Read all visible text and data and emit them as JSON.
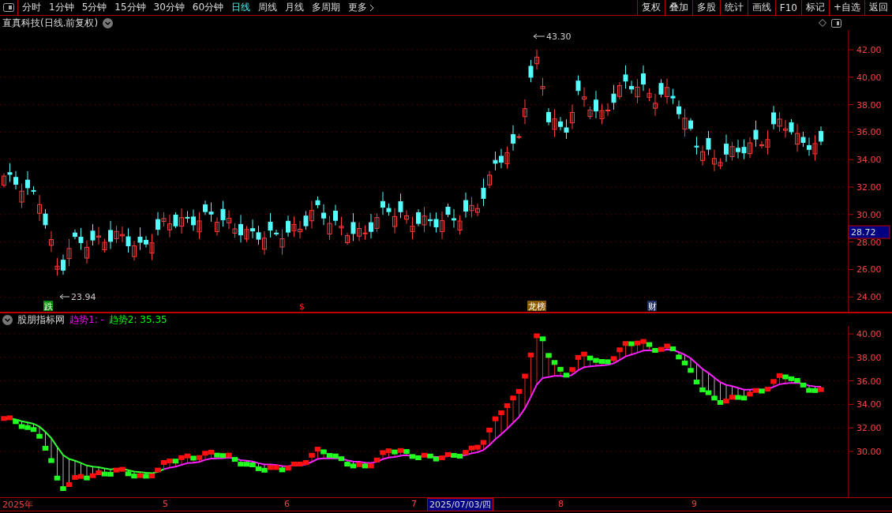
{
  "toolbar": {
    "periods": [
      {
        "label": "分时",
        "selected": false
      },
      {
        "label": "1分钟",
        "selected": false
      },
      {
        "label": "5分钟",
        "selected": false
      },
      {
        "label": "15分钟",
        "selected": false
      },
      {
        "label": "30分钟",
        "selected": false
      },
      {
        "label": "60分钟",
        "selected": false
      },
      {
        "label": "日线",
        "selected": true
      },
      {
        "label": "周线",
        "selected": false
      },
      {
        "label": "月线",
        "selected": false
      },
      {
        "label": "多周期",
        "selected": false
      },
      {
        "label": "更多",
        "selected": false
      }
    ],
    "buttons": [
      "复权",
      "叠加",
      "多股",
      "统计",
      "画线",
      "F10",
      "标记",
      "+自选",
      "返回"
    ]
  },
  "chart": {
    "title": "直真科技(日线.前复权)",
    "high_label": "43.30",
    "low_label": "23.94",
    "current_price": "28.72",
    "y_axis_labels": [
      "42.00",
      "40.00",
      "38.00",
      "36.00",
      "34.00",
      "32.00",
      "30.00",
      "28.00",
      "26.00",
      "24.00"
    ],
    "events": [
      {
        "label": "跌",
        "kind": "drop"
      },
      {
        "label": "$",
        "kind": "dollar"
      },
      {
        "label": "龙榜",
        "kind": "rank"
      },
      {
        "label": "财",
        "kind": "finance"
      }
    ]
  },
  "indicator": {
    "name": "股朋指标网",
    "legend": [
      {
        "label": "趋势1: -",
        "color": "#ff00ff"
      },
      {
        "label": "趋势2: 35.35",
        "color": "#00ff00"
      }
    ],
    "y_axis_labels": [
      "40.00",
      "38.00",
      "36.00",
      "34.00",
      "32.00",
      "30.00"
    ]
  },
  "date_axis": [
    {
      "label": "2025年",
      "selected": false
    },
    {
      "label": "5",
      "selected": false
    },
    {
      "label": "6",
      "selected": false
    },
    {
      "label": "7",
      "selected": false
    },
    {
      "label": "2025/07/03/四",
      "selected": true
    },
    {
      "label": "8",
      "selected": false
    },
    {
      "label": "9",
      "selected": false
    }
  ]
}
